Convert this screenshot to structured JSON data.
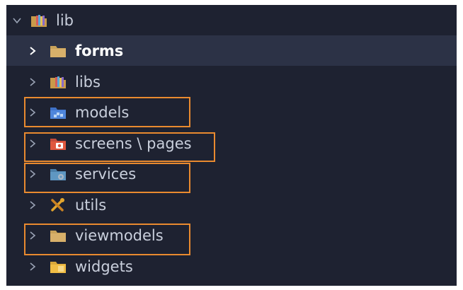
{
  "explorer": {
    "root": {
      "label": "lib",
      "expanded": true,
      "icon": "folder-lib-icon"
    },
    "items": [
      {
        "label": "forms",
        "icon": "folder-plain-icon",
        "selected": true
      },
      {
        "label": "libs",
        "icon": "folder-lib-icon",
        "selected": false
      },
      {
        "label": "models",
        "icon": "folder-models-icon",
        "selected": false,
        "highlighted": true
      },
      {
        "label": "screens \\ pages",
        "icon": "folder-screens-icon",
        "selected": false,
        "highlighted": true
      },
      {
        "label": "services",
        "icon": "folder-services-icon",
        "selected": false,
        "highlighted": true
      },
      {
        "label": "utils",
        "icon": "utils-tools-icon",
        "selected": false
      },
      {
        "label": "viewmodels",
        "icon": "folder-plain-icon",
        "selected": false,
        "highlighted": true
      },
      {
        "label": "widgets",
        "icon": "folder-widgets-icon",
        "selected": false
      }
    ]
  },
  "colors": {
    "panel_background": "#1e2231",
    "selected_row": "#2c3246",
    "text": "#c9cfdc",
    "highlight_border": "#e98a2f"
  }
}
